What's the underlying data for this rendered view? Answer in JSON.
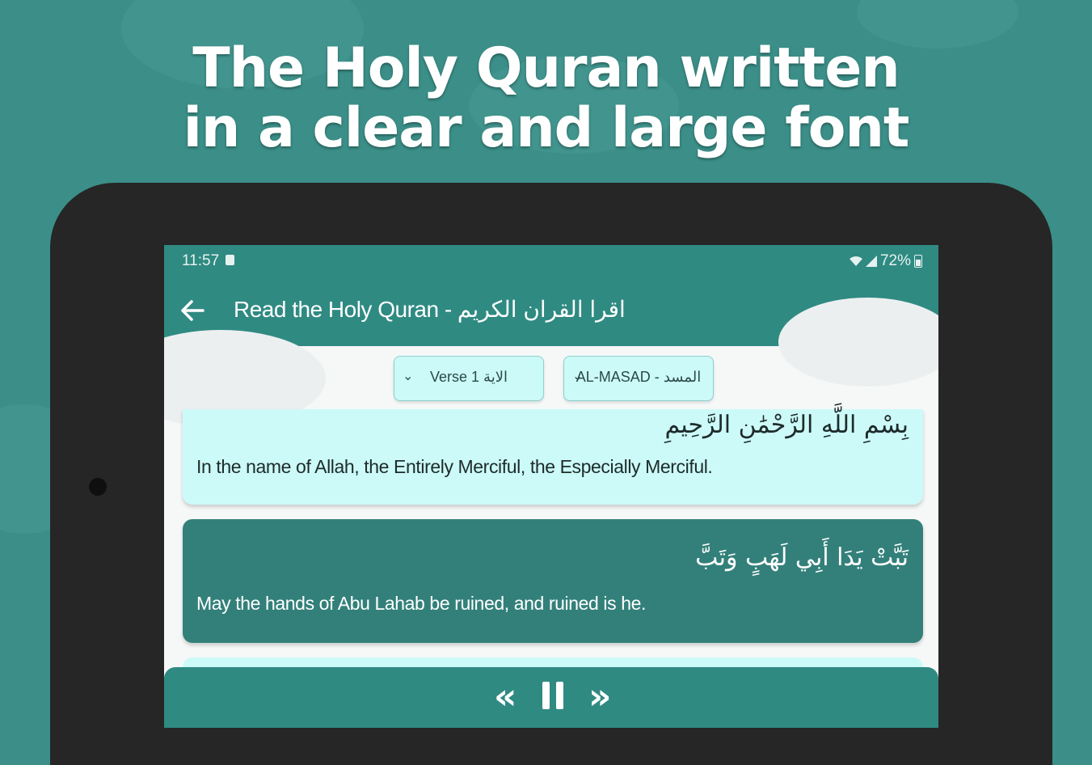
{
  "headline": {
    "line1": "The Holy Quran written",
    "line2": "in a clear and large font"
  },
  "status_bar": {
    "time": "11:57",
    "battery": "72%"
  },
  "app_bar": {
    "title": "Read the Holy Quran - اقرا القران الكريم",
    "back_icon": "arrow-left-icon"
  },
  "selectors": {
    "verse": "Verse 1 الاية",
    "surah": "AL-MASAD - المسد"
  },
  "verses": [
    {
      "arabic": "بِسْمِ اللَّهِ الرَّحْمَٰنِ الرَّحِيمِ",
      "translation": "In the name of Allah, the Entirely Merciful, the Especially Merciful."
    },
    {
      "arabic": "تَبَّتْ يَدَا أَبِي لَهَبٍ وَتَبَّ",
      "translation": "May the hands of Abu Lahab be ruined, and ruined is he."
    }
  ],
  "player": {
    "prev": "«",
    "next": "»",
    "icons": [
      "rewind-icon",
      "pause-icon",
      "fast-forward-icon"
    ]
  },
  "colors": {
    "background": "#3b8f88",
    "app_bar": "#2f8a82",
    "light_card": "#ccfaf8",
    "dark_card": "#33807a"
  }
}
